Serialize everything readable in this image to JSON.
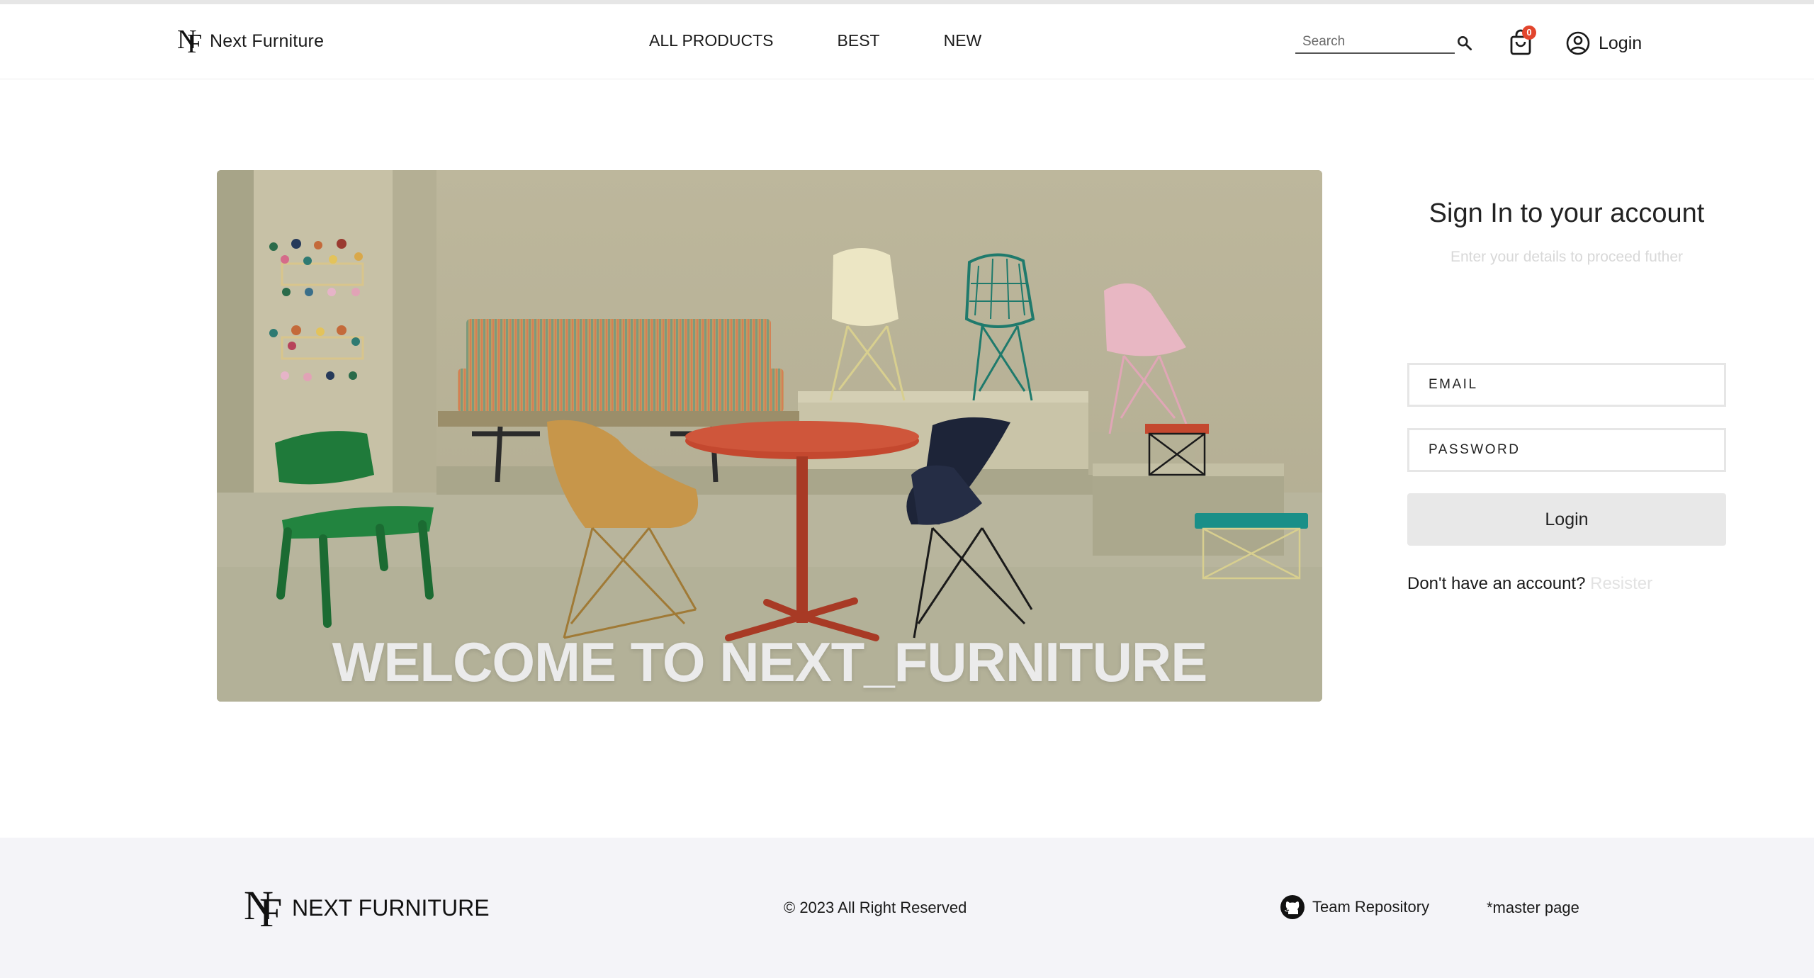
{
  "header": {
    "brand": {
      "logo_letters": [
        "N",
        "F"
      ],
      "name": "Next Furniture"
    },
    "nav": [
      {
        "label": "ALL PRODUCTS"
      },
      {
        "label": "BEST"
      },
      {
        "label": "NEW"
      }
    ],
    "search": {
      "placeholder": "Search",
      "icon": "search-icon"
    },
    "cart": {
      "icon": "shopping-bag-icon",
      "count": "0"
    },
    "account": {
      "icon": "user-circle-icon",
      "label": "Login"
    }
  },
  "hero": {
    "title": "WELCOME TO NEXT_FURNITURE",
    "image": "furniture showroom"
  },
  "signin": {
    "title": "Sign In to your account",
    "subtitle": "Enter your details to proceed futher",
    "email_placeholder": "EMAIL",
    "password_placeholder": "PASSWORD",
    "login_button": "Login",
    "register_prompt": "Don't have an account?",
    "register_link": "Resister"
  },
  "footer": {
    "brand": {
      "logo_letters": [
        "N",
        "F"
      ],
      "name": "NEXT FURNITURE"
    },
    "copyright": "© 2023 All Right Reserved",
    "repo": {
      "icon": "github-icon",
      "label": "Team Repository"
    },
    "note": "*master page"
  },
  "colors": {
    "badge": "#e2452d",
    "footer_bg": "#f4f4f8",
    "button_bg": "#e8e8e8"
  }
}
